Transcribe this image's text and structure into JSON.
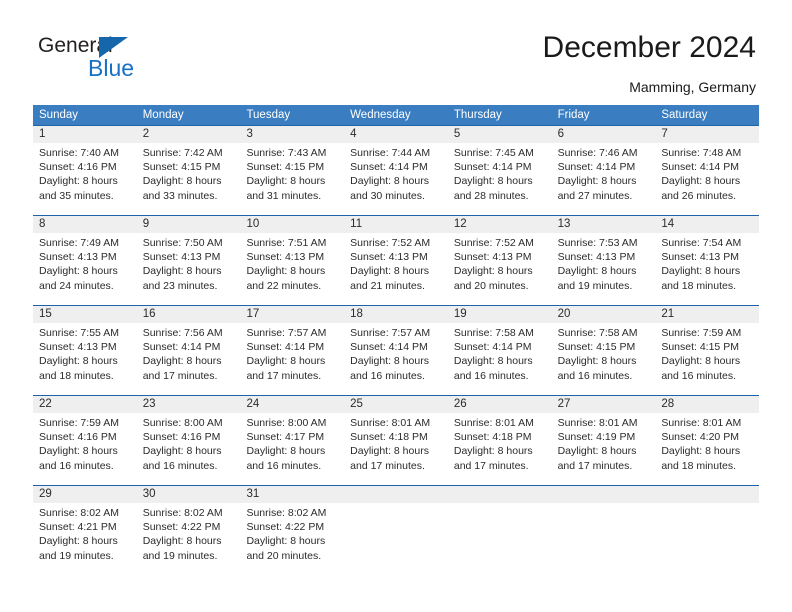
{
  "brand": {
    "name_part1": "General",
    "name_part2": "Blue",
    "triangle_icon": "triangle-icon",
    "accent_color": "#1871c4"
  },
  "header": {
    "title": "December 2024",
    "subtitle": "Mamming, Germany"
  },
  "calendar": {
    "header_bg": "#3a7dc0",
    "row_divider_color": "#1e62a8",
    "daynum_bg": "#efefef",
    "weekdays": [
      "Sunday",
      "Monday",
      "Tuesday",
      "Wednesday",
      "Thursday",
      "Friday",
      "Saturday"
    ],
    "weeks": [
      [
        {
          "day": "1",
          "sunrise": "Sunrise: 7:40 AM",
          "sunset": "Sunset: 4:16 PM",
          "daylight1": "Daylight: 8 hours",
          "daylight2": "and 35 minutes."
        },
        {
          "day": "2",
          "sunrise": "Sunrise: 7:42 AM",
          "sunset": "Sunset: 4:15 PM",
          "daylight1": "Daylight: 8 hours",
          "daylight2": "and 33 minutes."
        },
        {
          "day": "3",
          "sunrise": "Sunrise: 7:43 AM",
          "sunset": "Sunset: 4:15 PM",
          "daylight1": "Daylight: 8 hours",
          "daylight2": "and 31 minutes."
        },
        {
          "day": "4",
          "sunrise": "Sunrise: 7:44 AM",
          "sunset": "Sunset: 4:14 PM",
          "daylight1": "Daylight: 8 hours",
          "daylight2": "and 30 minutes."
        },
        {
          "day": "5",
          "sunrise": "Sunrise: 7:45 AM",
          "sunset": "Sunset: 4:14 PM",
          "daylight1": "Daylight: 8 hours",
          "daylight2": "and 28 minutes."
        },
        {
          "day": "6",
          "sunrise": "Sunrise: 7:46 AM",
          "sunset": "Sunset: 4:14 PM",
          "daylight1": "Daylight: 8 hours",
          "daylight2": "and 27 minutes."
        },
        {
          "day": "7",
          "sunrise": "Sunrise: 7:48 AM",
          "sunset": "Sunset: 4:14 PM",
          "daylight1": "Daylight: 8 hours",
          "daylight2": "and 26 minutes."
        }
      ],
      [
        {
          "day": "8",
          "sunrise": "Sunrise: 7:49 AM",
          "sunset": "Sunset: 4:13 PM",
          "daylight1": "Daylight: 8 hours",
          "daylight2": "and 24 minutes."
        },
        {
          "day": "9",
          "sunrise": "Sunrise: 7:50 AM",
          "sunset": "Sunset: 4:13 PM",
          "daylight1": "Daylight: 8 hours",
          "daylight2": "and 23 minutes."
        },
        {
          "day": "10",
          "sunrise": "Sunrise: 7:51 AM",
          "sunset": "Sunset: 4:13 PM",
          "daylight1": "Daylight: 8 hours",
          "daylight2": "and 22 minutes."
        },
        {
          "day": "11",
          "sunrise": "Sunrise: 7:52 AM",
          "sunset": "Sunset: 4:13 PM",
          "daylight1": "Daylight: 8 hours",
          "daylight2": "and 21 minutes."
        },
        {
          "day": "12",
          "sunrise": "Sunrise: 7:52 AM",
          "sunset": "Sunset: 4:13 PM",
          "daylight1": "Daylight: 8 hours",
          "daylight2": "and 20 minutes."
        },
        {
          "day": "13",
          "sunrise": "Sunrise: 7:53 AM",
          "sunset": "Sunset: 4:13 PM",
          "daylight1": "Daylight: 8 hours",
          "daylight2": "and 19 minutes."
        },
        {
          "day": "14",
          "sunrise": "Sunrise: 7:54 AM",
          "sunset": "Sunset: 4:13 PM",
          "daylight1": "Daylight: 8 hours",
          "daylight2": "and 18 minutes."
        }
      ],
      [
        {
          "day": "15",
          "sunrise": "Sunrise: 7:55 AM",
          "sunset": "Sunset: 4:13 PM",
          "daylight1": "Daylight: 8 hours",
          "daylight2": "and 18 minutes."
        },
        {
          "day": "16",
          "sunrise": "Sunrise: 7:56 AM",
          "sunset": "Sunset: 4:14 PM",
          "daylight1": "Daylight: 8 hours",
          "daylight2": "and 17 minutes."
        },
        {
          "day": "17",
          "sunrise": "Sunrise: 7:57 AM",
          "sunset": "Sunset: 4:14 PM",
          "daylight1": "Daylight: 8 hours",
          "daylight2": "and 17 minutes."
        },
        {
          "day": "18",
          "sunrise": "Sunrise: 7:57 AM",
          "sunset": "Sunset: 4:14 PM",
          "daylight1": "Daylight: 8 hours",
          "daylight2": "and 16 minutes."
        },
        {
          "day": "19",
          "sunrise": "Sunrise: 7:58 AM",
          "sunset": "Sunset: 4:14 PM",
          "daylight1": "Daylight: 8 hours",
          "daylight2": "and 16 minutes."
        },
        {
          "day": "20",
          "sunrise": "Sunrise: 7:58 AM",
          "sunset": "Sunset: 4:15 PM",
          "daylight1": "Daylight: 8 hours",
          "daylight2": "and 16 minutes."
        },
        {
          "day": "21",
          "sunrise": "Sunrise: 7:59 AM",
          "sunset": "Sunset: 4:15 PM",
          "daylight1": "Daylight: 8 hours",
          "daylight2": "and 16 minutes."
        }
      ],
      [
        {
          "day": "22",
          "sunrise": "Sunrise: 7:59 AM",
          "sunset": "Sunset: 4:16 PM",
          "daylight1": "Daylight: 8 hours",
          "daylight2": "and 16 minutes."
        },
        {
          "day": "23",
          "sunrise": "Sunrise: 8:00 AM",
          "sunset": "Sunset: 4:16 PM",
          "daylight1": "Daylight: 8 hours",
          "daylight2": "and 16 minutes."
        },
        {
          "day": "24",
          "sunrise": "Sunrise: 8:00 AM",
          "sunset": "Sunset: 4:17 PM",
          "daylight1": "Daylight: 8 hours",
          "daylight2": "and 16 minutes."
        },
        {
          "day": "25",
          "sunrise": "Sunrise: 8:01 AM",
          "sunset": "Sunset: 4:18 PM",
          "daylight1": "Daylight: 8 hours",
          "daylight2": "and 17 minutes."
        },
        {
          "day": "26",
          "sunrise": "Sunrise: 8:01 AM",
          "sunset": "Sunset: 4:18 PM",
          "daylight1": "Daylight: 8 hours",
          "daylight2": "and 17 minutes."
        },
        {
          "day": "27",
          "sunrise": "Sunrise: 8:01 AM",
          "sunset": "Sunset: 4:19 PM",
          "daylight1": "Daylight: 8 hours",
          "daylight2": "and 17 minutes."
        },
        {
          "day": "28",
          "sunrise": "Sunrise: 8:01 AM",
          "sunset": "Sunset: 4:20 PM",
          "daylight1": "Daylight: 8 hours",
          "daylight2": "and 18 minutes."
        }
      ],
      [
        {
          "day": "29",
          "sunrise": "Sunrise: 8:02 AM",
          "sunset": "Sunset: 4:21 PM",
          "daylight1": "Daylight: 8 hours",
          "daylight2": "and 19 minutes."
        },
        {
          "day": "30",
          "sunrise": "Sunrise: 8:02 AM",
          "sunset": "Sunset: 4:22 PM",
          "daylight1": "Daylight: 8 hours",
          "daylight2": "and 19 minutes."
        },
        {
          "day": "31",
          "sunrise": "Sunrise: 8:02 AM",
          "sunset": "Sunset: 4:22 PM",
          "daylight1": "Daylight: 8 hours",
          "daylight2": "and 20 minutes."
        },
        {
          "day": "",
          "sunrise": "",
          "sunset": "",
          "daylight1": "",
          "daylight2": ""
        },
        {
          "day": "",
          "sunrise": "",
          "sunset": "",
          "daylight1": "",
          "daylight2": ""
        },
        {
          "day": "",
          "sunrise": "",
          "sunset": "",
          "daylight1": "",
          "daylight2": ""
        },
        {
          "day": "",
          "sunrise": "",
          "sunset": "",
          "daylight1": "",
          "daylight2": ""
        }
      ]
    ]
  }
}
